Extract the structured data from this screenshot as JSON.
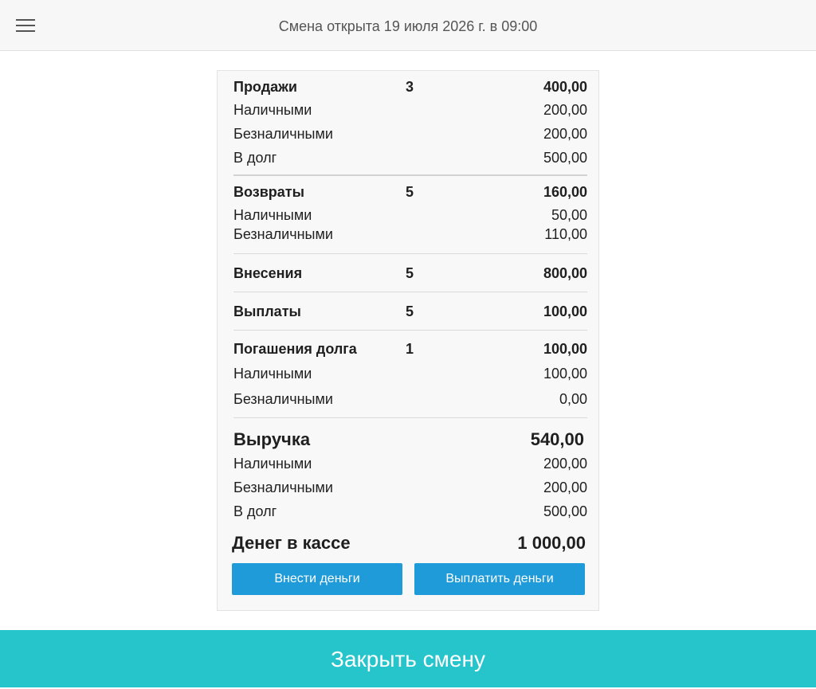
{
  "header": {
    "shift_status": "Смена открыта 19 июля 2026 г. в 09:00"
  },
  "report": {
    "sales": {
      "label": "Продажи",
      "count": "3",
      "total": "400,00",
      "cash_label": "Наличными",
      "cash": "200,00",
      "card_label": "Безналичными",
      "card": "200,00",
      "debt_label": "В долг",
      "debt": "500,00"
    },
    "returns": {
      "label": "Возвраты",
      "count": "5",
      "total": "160,00",
      "cash_label": "Наличными",
      "cash": "50,00",
      "card_label": "Безналичными",
      "card": "110,00"
    },
    "deposits": {
      "label": "Внесения",
      "count": "5",
      "total": "800,00"
    },
    "payouts": {
      "label": "Выплаты",
      "count": "5",
      "total": "100,00"
    },
    "debt_repayments": {
      "label": "Погашения долга",
      "count": "1",
      "total": "100,00",
      "cash_label": "Наличными",
      "cash": "100,00",
      "card_label": "Безналичными",
      "card": "0,00"
    },
    "revenue": {
      "label": "Выручка",
      "total": "540,00",
      "cash_label": "Наличными",
      "cash": "200,00",
      "card_label": "Безналичными",
      "card": "200,00",
      "debt_label": "В долг",
      "debt": "500,00"
    },
    "cash_in_register": {
      "label": "Денег в кассе",
      "total": "1 000,00"
    }
  },
  "actions": {
    "deposit_label": "Внести деньги",
    "payout_label": "Выплатить деньги",
    "close_shift_label": "Закрыть смену"
  },
  "colors": {
    "accent_button": "#1f9bd9",
    "close_bar": "#26c4cb"
  }
}
